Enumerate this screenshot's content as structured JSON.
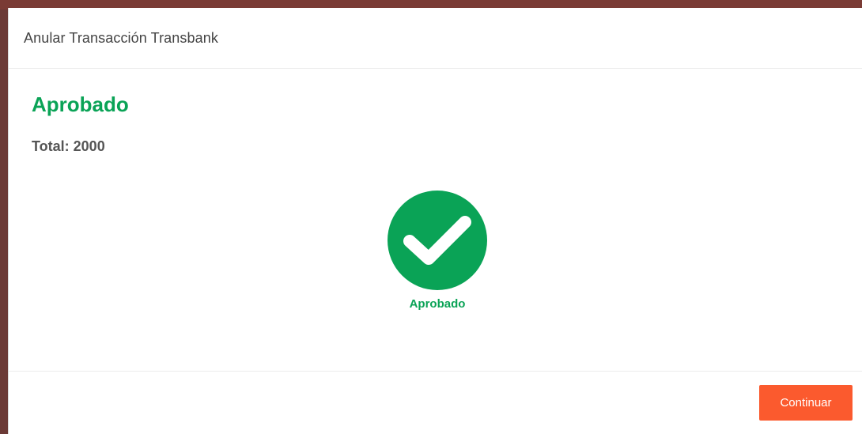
{
  "modal": {
    "title": "Anular Transacción Transbank"
  },
  "result": {
    "status": "Aprobado",
    "total_line": "Total: 2000",
    "icon_label": "Aprobado",
    "icon": "check-circle-icon",
    "accent_color": "#0aa356"
  },
  "footer": {
    "continue_label": "Continuar",
    "button_color": "#fb5a2e"
  }
}
